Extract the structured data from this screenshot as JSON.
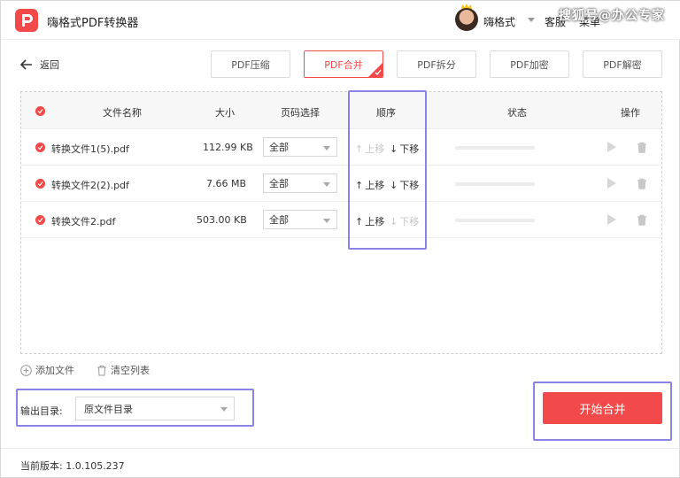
{
  "app": {
    "title": "嗨格式PDF转换器",
    "user": "嗨格式",
    "service_label": "客服",
    "menu_label": "菜单",
    "watermark": "搜狐号@办公专家",
    "accent_color": "#f24a4a",
    "highlight_color": "#8b82e8"
  },
  "nav": {
    "back_label": "返回",
    "tabs": [
      {
        "label": "PDF压缩",
        "active": false
      },
      {
        "label": "PDF合并",
        "active": true
      },
      {
        "label": "PDF拆分",
        "active": false
      },
      {
        "label": "PDF加密",
        "active": false
      },
      {
        "label": "PDF解密",
        "active": false
      }
    ]
  },
  "table": {
    "headers": {
      "name": "文件名称",
      "size": "大小",
      "pages": "页码选择",
      "order": "顺序",
      "status": "状态",
      "actions": "操作"
    },
    "rows": [
      {
        "name": "转换文件1(5).pdf",
        "size": "112.99 KB",
        "pages": "全部",
        "up": "上移",
        "down": "下移",
        "up_enabled": false,
        "down_enabled": true,
        "progress": 0
      },
      {
        "name": "转换文件2(2).pdf",
        "size": "7.66 MB",
        "pages": "全部",
        "up": "上移",
        "down": "下移",
        "up_enabled": true,
        "down_enabled": true,
        "progress": 0
      },
      {
        "name": "转换文件2.pdf",
        "size": "503.00 KB",
        "pages": "全部",
        "up": "上移",
        "down": "下移",
        "up_enabled": true,
        "down_enabled": false,
        "progress": 0
      }
    ]
  },
  "toolbar": {
    "add_file": "添加文件",
    "clear_list": "清空列表"
  },
  "output": {
    "label": "输出目录:",
    "value": "原文件目录"
  },
  "start_button": "开始合并",
  "footer": {
    "version": "当前版本: 1.0.105.237"
  }
}
